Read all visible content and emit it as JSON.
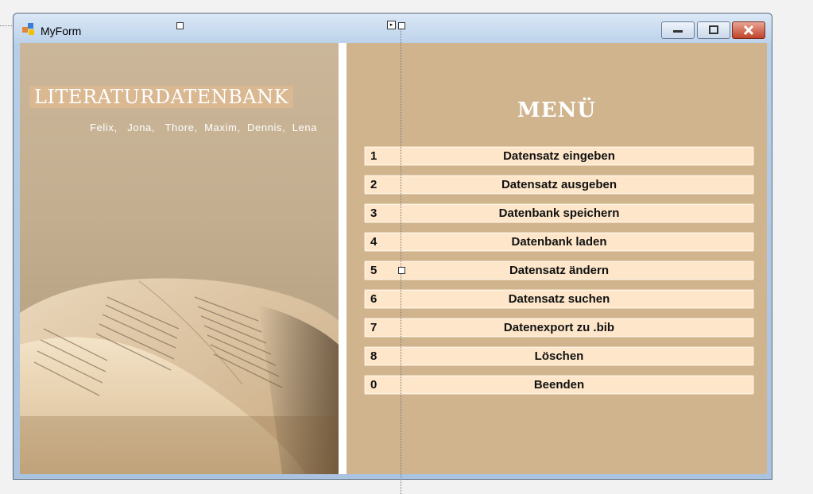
{
  "window": {
    "title": "MyForm",
    "controls": {
      "minimize": "minimize-icon",
      "maximize": "maximize-icon",
      "close": "close-icon"
    }
  },
  "left_panel": {
    "title": "LITERATURDATENBANK",
    "authors": "Felix,   Jona,   Thore,  Maxim,  Dennis,  Lena"
  },
  "menu": {
    "title": "MENÜ",
    "items": [
      {
        "key": "1",
        "label": "Datensatz eingeben"
      },
      {
        "key": "2",
        "label": "Datensatz ausgeben"
      },
      {
        "key": "3",
        "label": "Datenbank speichern"
      },
      {
        "key": "4",
        "label": "Datenbank laden"
      },
      {
        "key": "5",
        "label": "Datensatz ändern"
      },
      {
        "key": "6",
        "label": "Datensatz suchen"
      },
      {
        "key": "7",
        "label": "Datenexport zu .bib"
      },
      {
        "key": "8",
        "label": "Löschen"
      },
      {
        "key": "0",
        "label": "Beenden"
      }
    ]
  },
  "colors": {
    "panel_bg": "#cfb48e",
    "button_bg": "#fde6c9",
    "title_badge": "#d9b892",
    "close_button": "#c1432a"
  }
}
